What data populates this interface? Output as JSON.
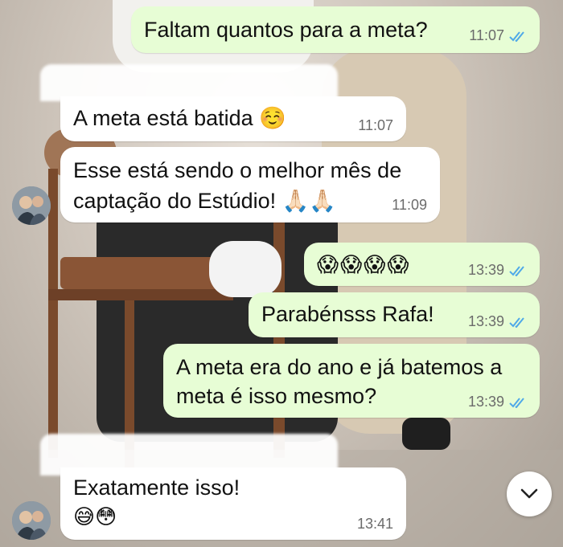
{
  "messages": [
    {
      "id": "m1",
      "side": "out",
      "lines": [
        "Faltam quantos para a meta?"
      ],
      "time": "11:07",
      "read": true
    },
    {
      "id": "m2",
      "side": "in",
      "lines": [
        "A meta está batida ☺️"
      ],
      "time": "11:07"
    },
    {
      "id": "m3",
      "side": "in",
      "lines": [
        "Esse está sendo o melhor mês de",
        "captação do Estúdio! 🙏🏻🙏🏻"
      ],
      "time": "11:09"
    },
    {
      "id": "m4",
      "side": "out",
      "lines": [
        "😱😱😱😱"
      ],
      "time": "13:39",
      "read": true
    },
    {
      "id": "m5",
      "side": "out",
      "lines": [
        "Parabénsss Rafa!"
      ],
      "time": "13:39",
      "read": true
    },
    {
      "id": "m6",
      "side": "out",
      "lines": [
        "A meta era do ano e já batemos a",
        "meta é isso mesmo?"
      ],
      "time": "13:39",
      "read": true
    },
    {
      "id": "m7",
      "side": "in",
      "lines": [
        "Exatamente isso!",
        "😅😳"
      ],
      "time": "13:41"
    }
  ],
  "colors": {
    "outgoing": "#e7fdd5",
    "incoming": "#ffffff",
    "read_ticks": "#4fa9e8"
  },
  "icons": {
    "scroll_down": "chevron-down-icon",
    "read_receipt": "double-check-icon"
  }
}
